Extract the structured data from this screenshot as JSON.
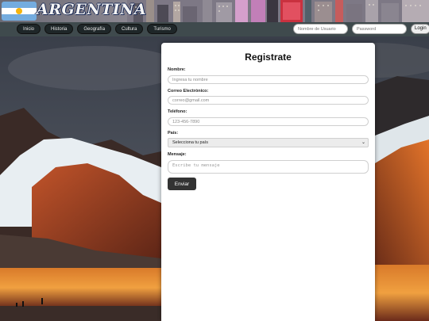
{
  "header": {
    "brand": "ARGENTINA"
  },
  "nav": {
    "items": [
      {
        "label": "Inicio"
      },
      {
        "label": "Historia"
      },
      {
        "label": "Geografía"
      },
      {
        "label": "Cultura"
      },
      {
        "label": "Turismo"
      }
    ],
    "login": {
      "user_placeholder": "Nombre de Usuario",
      "pass_placeholder": "Password",
      "button_label": "Login"
    }
  },
  "form": {
    "title": "Registrate",
    "name_label": "Nombre:",
    "name_placeholder": "Ingresa tu nombre",
    "email_label": "Correo Electrónico:",
    "email_placeholder": "correo@gmail.com",
    "phone_label": "Teléfono:",
    "phone_placeholder": "123-456-7890",
    "country_label": "País:",
    "country_selected": "Selecciona tu país",
    "message_label": "Mensaje:",
    "message_placeholder": "Escribe tu mensaje",
    "submit_label": "Enviar"
  },
  "colors": {
    "nav_bg": "#3f4a4d",
    "nav_button": "#1e2628",
    "submit_bg": "#333333",
    "flag_blue": "#74acdf",
    "flag_sun": "#f6b40e"
  }
}
